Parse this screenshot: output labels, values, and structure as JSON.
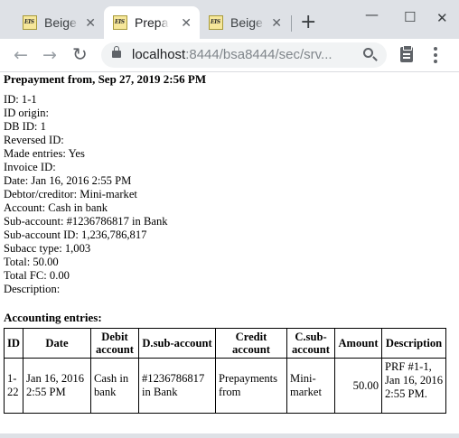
{
  "browser": {
    "tabs": [
      {
        "title": "Beige",
        "favicon_text": "EIS",
        "active": false
      },
      {
        "title": "Prepa",
        "favicon_text": "EIS",
        "active": true
      },
      {
        "title": "Beige",
        "favicon_text": "EIS",
        "active": false
      }
    ],
    "new_tab": "+",
    "window_controls": {
      "minimize": "—",
      "maximize": "☐",
      "close": "✕"
    },
    "nav": {
      "back": "←",
      "forward": "→",
      "reload": "↻"
    },
    "url_host": "localhost",
    "url_rest": ":8444/bsa8444/sec/srv...",
    "icons": [
      "lock-icon",
      "zoom-icon",
      "clipboard-icon",
      "menu-icon"
    ]
  },
  "page": {
    "title": "Prepayment from, Sep 27, 2019 2:56 PM",
    "fields": [
      "ID: 1-1",
      "ID origin:",
      "DB ID: 1",
      "Reversed ID:",
      "Made entries: Yes",
      "Invoice ID:",
      "Date: Jan 16, 2016 2:55 PM",
      "Debtor/creditor: Mini-market",
      "Account: Cash in bank",
      "Sub-account: #1236786817 in Bank",
      "Sub-account ID: 1,236,786,817",
      "Subacc type: 1,003",
      "Total: 50.00",
      "Total FC: 0.00",
      "Description:"
    ],
    "entries_title": "Accounting entries:",
    "entries_table": {
      "headers": [
        "ID",
        "Date",
        "Debit account",
        "D.sub-account",
        "Credit account",
        "C.sub-account",
        "Amount",
        "Description"
      ],
      "rows": [
        {
          "id": "1-22",
          "date": "Jan 16, 2016 2:55 PM",
          "debit_account": "Cash in bank",
          "d_sub_account": "#1236786817 in Bank",
          "credit_account": "Prepayments from",
          "c_sub_account": "Mini-market",
          "amount": "50.00",
          "description": "PRF #1-1, Jan 16, 2016 2:55 PM."
        }
      ]
    }
  }
}
